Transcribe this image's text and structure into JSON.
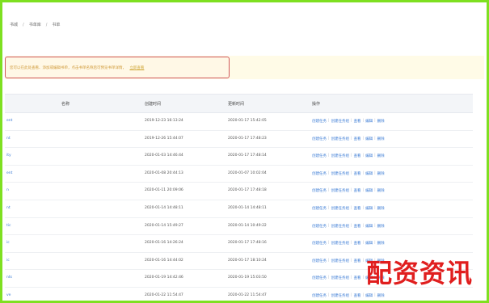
{
  "breadcrumb": [
    "书城",
    "书单库",
    "书单"
  ],
  "notice": {
    "text": "您可以在此处查看、添加或编辑书单，点击书单名称后可预览书单详情，",
    "link": "立即查看"
  },
  "table": {
    "headers": [
      "",
      "名称",
      "创建时间",
      "更新时间",
      "操作"
    ],
    "rows": [
      {
        "name": "ent",
        "created": "2019-12-23 16:13:24",
        "updated": "2020-01-17 15:42:05"
      },
      {
        "name": "nt",
        "created": "2019-12-26 15:44:07",
        "updated": "2020-01-17 17:48:23"
      },
      {
        "name": "ity",
        "created": "2020-01-03 14:46:44",
        "updated": "2020-01-17 17:48:14"
      },
      {
        "name": "ent",
        "created": "2020-01-08 20:44:13",
        "updated": "2020-01-07 10:02:04"
      },
      {
        "name": "n",
        "created": "2020-01-11 20:09:06",
        "updated": "2020-01-17 17:48:18"
      },
      {
        "name": "nt",
        "created": "2020-01-14 14:48:11",
        "updated": "2020-01-14 14:48:11"
      },
      {
        "name": "tic",
        "created": "2020-01-14 15:49:27",
        "updated": "2020-01-14 10:49:22"
      },
      {
        "name": "ic",
        "created": "2020-01-16 14:26:24",
        "updated": "2020-01-17 17:48:16"
      },
      {
        "name": "ic",
        "created": "2020-01-16 14:44:02",
        "updated": "2020-01-17 18:10:24"
      },
      {
        "name": "nts",
        "created": "2020-01-19 14:42:46",
        "updated": "2020-01-19 15:03:50"
      },
      {
        "name": "ve",
        "created": "2020-01-22 11:54:47",
        "updated": "2020-01-22 11:54:47"
      }
    ],
    "actions": [
      "创建任务",
      "创建任务组",
      "查看",
      "编辑",
      "删除"
    ]
  },
  "watermark": "配资资讯",
  "colors": {
    "border": "#7ee021",
    "link": "#3a7bd5",
    "notice_border": "#d0585a",
    "watermark": "#e01e1e"
  }
}
